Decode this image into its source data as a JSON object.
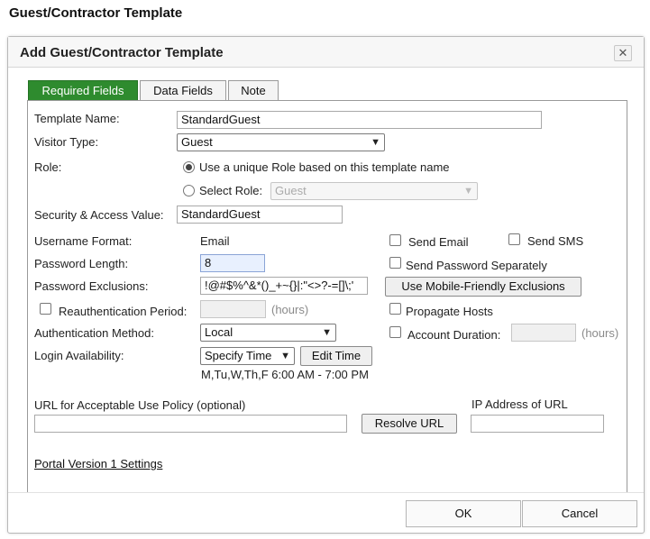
{
  "page_title": "Guest/Contractor Template",
  "dialog": {
    "title": "Add Guest/Contractor Template",
    "close_icon": "✕"
  },
  "tabs": [
    {
      "label": "Required Fields",
      "active": true
    },
    {
      "label": "Data Fields",
      "active": false
    },
    {
      "label": "Note",
      "active": false
    }
  ],
  "form": {
    "template_name": {
      "label": "Template Name:",
      "value": "StandardGuest"
    },
    "visitor_type": {
      "label": "Visitor Type:",
      "value": "Guest"
    },
    "role": {
      "label": "Role:",
      "option_unique": "Use a unique Role based on this template name",
      "option_select": "Select Role:",
      "select_value": "Guest",
      "selected": "unique"
    },
    "security_access": {
      "label": "Security & Access Value:",
      "value": "StandardGuest"
    },
    "username_format": {
      "label": "Username Format:",
      "value": "Email"
    },
    "send_email": {
      "label": "Send Email",
      "checked": false
    },
    "send_sms": {
      "label": "Send SMS",
      "checked": false
    },
    "password_length": {
      "label": "Password Length:",
      "value": "8"
    },
    "send_password_separately": {
      "label": "Send Password Separately",
      "checked": false
    },
    "password_exclusions": {
      "label": "Password Exclusions:",
      "value": "!@#$%^&*()_+~{}|:\"<>?-=[]\\;'"
    },
    "mobile_friendly_button": "Use Mobile-Friendly Exclusions",
    "reauthentication": {
      "label": "Reauthentication Period:",
      "unit": "(hours)",
      "checked": false
    },
    "propagate_hosts": {
      "label": "Propagate Hosts",
      "checked": false
    },
    "authentication_method": {
      "label": "Authentication Method:",
      "value": "Local"
    },
    "account_duration": {
      "label": "Account Duration:",
      "unit": "(hours)",
      "checked": false
    },
    "login_availability": {
      "label": "Login Availability:",
      "value": "Specify Time",
      "edit_button": "Edit Time",
      "schedule": "M,Tu,W,Th,F 6:00 AM - 7:00 PM"
    },
    "aup_url": {
      "label": "URL for Acceptable Use Policy (optional)",
      "value": ""
    },
    "resolve_url_button": "Resolve URL",
    "ip_address": {
      "label": "IP Address of URL",
      "value": ""
    },
    "portal_settings_link": "Portal Version 1 Settings"
  },
  "footer": {
    "ok_label": "OK",
    "cancel_label": "Cancel"
  },
  "icons": {
    "dropdown": "chevron-down-icon",
    "close": "close-icon"
  },
  "colors": {
    "active_tab": "#2e8b2e",
    "highlight_field": "#e8f0fe"
  }
}
